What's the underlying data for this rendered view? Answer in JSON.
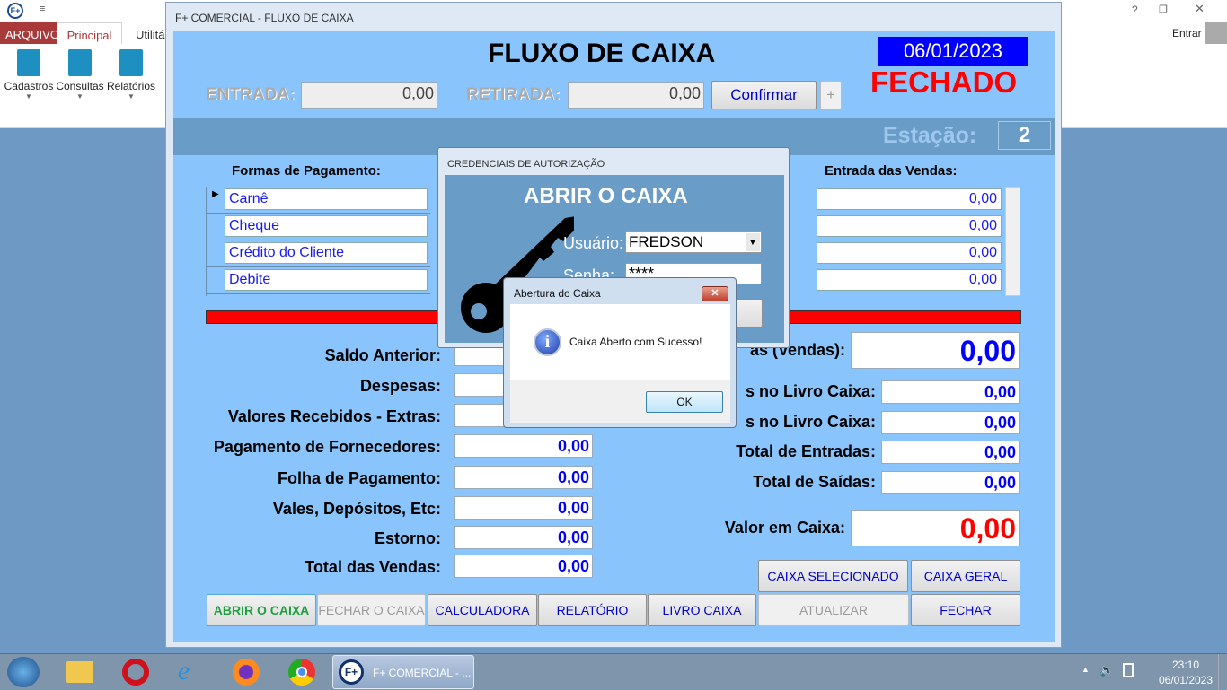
{
  "ribbon": {
    "tabs": [
      "ARQUIVO",
      "Principal",
      "Utilitá"
    ],
    "buttons": [
      {
        "label": "Cadastros",
        "icon": "document-add-icon"
      },
      {
        "label": "Consultas",
        "icon": "document-search-icon"
      },
      {
        "label": "Relatórios",
        "icon": "clipboard-chart-icon"
      }
    ],
    "help": "?",
    "login": "Entrar"
  },
  "window": {
    "title": "F+ COMERCIAL - FLUXO DE CAIXA",
    "heading": "FLUXO DE CAIXA",
    "date": "06/01/2023",
    "status": "FECHADO",
    "entrada_label": "ENTRADA:",
    "entrada_value": "0,00",
    "retirada_label": "RETIRADA:",
    "retirada_value": "0,00",
    "confirm": "Confirmar",
    "plus": "+",
    "estacao_label": "Estação:",
    "estacao_value": "2",
    "formas_header": "Formas de Pagamento:",
    "formas": [
      "Carnê",
      "Cheque",
      "Crédito do Cliente",
      "Debite"
    ],
    "entrada_vendas_header": "Entrada das Vendas:",
    "entrada_vendas": [
      "0,00",
      "0,00",
      "0,00",
      "0,00"
    ],
    "left_fields": [
      {
        "label": "Saldo Anterior:",
        "value": ""
      },
      {
        "label": "Despesas:",
        "value": ""
      },
      {
        "label": "Valores Recebidos - Extras:",
        "value": ""
      },
      {
        "label": "Pagamento de Fornecedores:",
        "value": "0,00"
      },
      {
        "label": "Folha de Pagamento:",
        "value": "0,00"
      },
      {
        "label": "Vales, Depósitos, Etc:",
        "value": "0,00"
      },
      {
        "label": "Estorno:",
        "value": "0,00"
      },
      {
        "label": "Total das Vendas:",
        "value": "0,00"
      }
    ],
    "right_fields": [
      {
        "label": "as (Vendas):",
        "value": "0,00"
      },
      {
        "label": "s no Livro Caixa:",
        "value": "0,00"
      },
      {
        "label": "s no Livro Caixa:",
        "value": "0,00"
      },
      {
        "label": "Total de Entradas:",
        "value": "0,00"
      },
      {
        "label": "Total de Saídas:",
        "value": "0,00"
      },
      {
        "label": "Valor em Caixa:",
        "value": "0,00"
      }
    ],
    "buttons": {
      "caixa_selecionado": "CAIXA SELECIONADO",
      "caixa_geral": "CAIXA GERAL",
      "abrir": "ABRIR O CAIXA",
      "fechar_caixa": "FECHAR O CAIXA",
      "calculadora": "CALCULADORA",
      "relatorio": "RELATÓRIO",
      "livro": "LIVRO CAIXA",
      "atualizar": "ATUALIZAR",
      "fechar": "FECHAR"
    }
  },
  "cred": {
    "title": "CREDENCIAIS DE AUTORIZAÇÃO",
    "heading": "ABRIR O CAIXA",
    "usuario_label": "Usuário:",
    "usuario": "FREDSON",
    "senha_label": "Senha:",
    "senha": "****"
  },
  "msg": {
    "title": "Abertura do Caixa",
    "text": "Caixa Aberto com Sucesso!",
    "ok": "OK"
  },
  "taskbar": {
    "task": "F+ COMERCIAL - ...",
    "time": "23:10",
    "date": "06/01/2023"
  },
  "colors": {
    "panel": "#8ac4fc",
    "band": "#6a9cc8",
    "red_bar": "#ff0000",
    "date_bg": "#0000ff",
    "status": "#ff0000"
  }
}
